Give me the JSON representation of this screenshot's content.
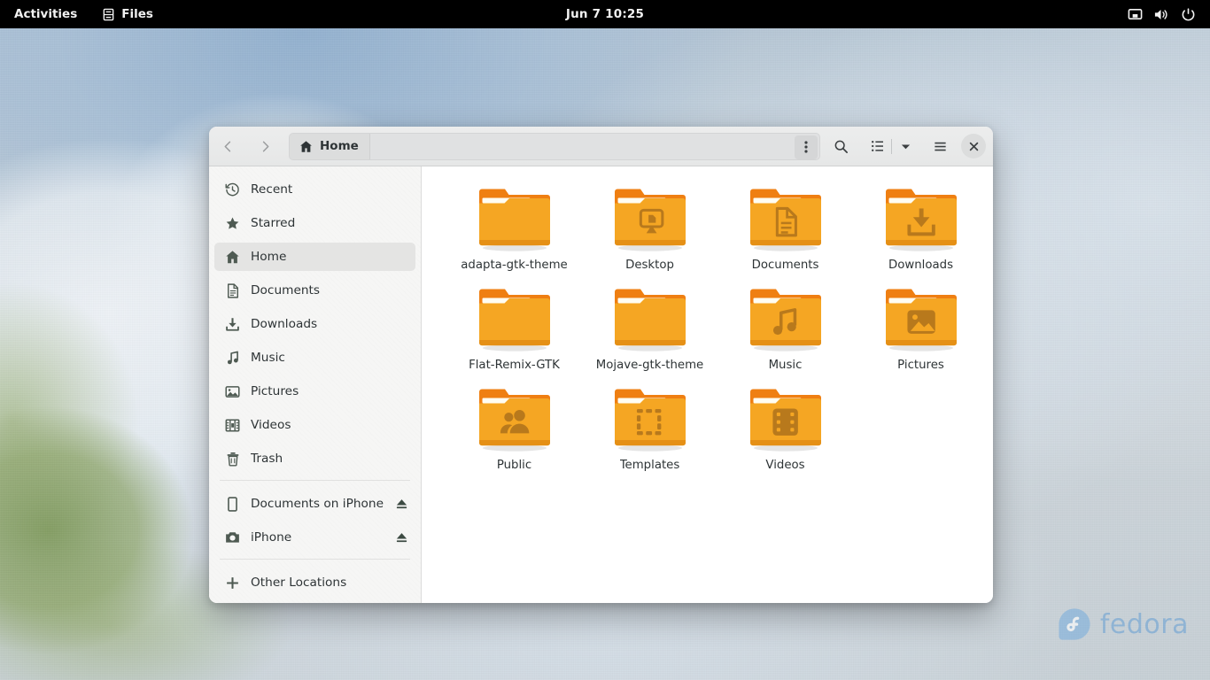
{
  "topbar": {
    "activities_label": "Activities",
    "app_name": "Files",
    "app_icon": "files-app-icon",
    "clock": "Jun 7  10:25",
    "tray": [
      {
        "name": "screen-share-icon",
        "glyph": "display"
      },
      {
        "name": "volume-icon",
        "glyph": "speaker"
      },
      {
        "name": "power-icon",
        "glyph": "power"
      }
    ],
    "background": "#000000"
  },
  "window": {
    "title": "Home",
    "headerbar": {
      "back_label": "Back",
      "forward_label": "Forward",
      "path_button_label": "Home",
      "path_menu_label": "Path bar menu",
      "search_label": "Search",
      "list_view_label": "List view",
      "view_options_label": "View options",
      "main_menu_label": "Main menu",
      "close_label": "Close"
    }
  },
  "sidebar": {
    "groups": [
      {
        "items": [
          {
            "label": "Recent",
            "icon": "clock-rotate-icon",
            "active": false,
            "eject": false
          },
          {
            "label": "Starred",
            "icon": "star-icon",
            "active": false,
            "eject": false
          },
          {
            "label": "Home",
            "icon": "home-icon",
            "active": true,
            "eject": false
          },
          {
            "label": "Documents",
            "icon": "document-icon",
            "active": false,
            "eject": false
          },
          {
            "label": "Downloads",
            "icon": "download-icon",
            "active": false,
            "eject": false
          },
          {
            "label": "Music",
            "icon": "music-note-icon",
            "active": false,
            "eject": false
          },
          {
            "label": "Pictures",
            "icon": "image-icon",
            "active": false,
            "eject": false
          },
          {
            "label": "Videos",
            "icon": "film-icon",
            "active": false,
            "eject": false
          },
          {
            "label": "Trash",
            "icon": "trash-icon",
            "active": false,
            "eject": false
          }
        ]
      },
      {
        "items": [
          {
            "label": "Documents on iPhone",
            "icon": "phone-icon",
            "active": false,
            "eject": true
          },
          {
            "label": "iPhone",
            "icon": "camera-icon",
            "active": false,
            "eject": true
          }
        ]
      },
      {
        "items": [
          {
            "label": "Other Locations",
            "icon": "plus-icon",
            "active": false,
            "eject": false
          }
        ]
      }
    ]
  },
  "files": [
    {
      "label": "adapta-gtk-theme",
      "emblem": "none"
    },
    {
      "label": "Desktop",
      "emblem": "desktop"
    },
    {
      "label": "Documents",
      "emblem": "document"
    },
    {
      "label": "Downloads",
      "emblem": "download"
    },
    {
      "label": "Flat-Remix-GTK",
      "emblem": "none"
    },
    {
      "label": "Mojave-gtk-theme",
      "emblem": "none"
    },
    {
      "label": "Music",
      "emblem": "music"
    },
    {
      "label": "Pictures",
      "emblem": "image"
    },
    {
      "label": "Public",
      "emblem": "people"
    },
    {
      "label": "Templates",
      "emblem": "template"
    },
    {
      "label": "Videos",
      "emblem": "film"
    }
  ],
  "desktop": {
    "watermark_text": "fedora",
    "watermark_icon": "fedora-logo-icon"
  },
  "colors": {
    "folder_body": "#f5a623",
    "folder_tab": "#ef7f12",
    "folder_emblem": "#b8791c",
    "accent_selected": "#e4e4e3",
    "fedora_blue": "#6ea3d4",
    "topbar_bg": "#000000",
    "window_bg": "#ffffff"
  }
}
